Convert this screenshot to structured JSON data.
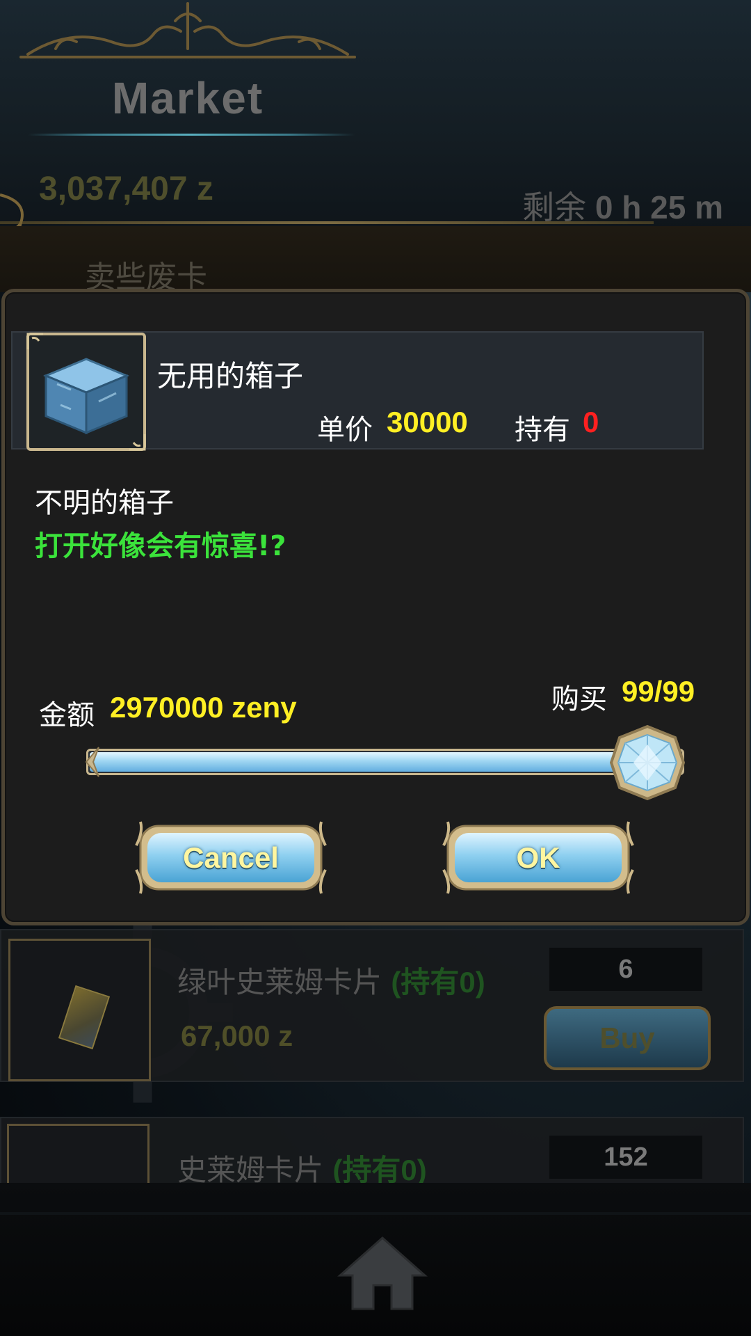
{
  "header": {
    "title": "Market",
    "money": "3,037,407 z",
    "remaining_label": "剩余",
    "remaining_value": " 0 h 25 m",
    "sell_label": "卖些废卡"
  },
  "dialog": {
    "item_name": "无用的箱子",
    "unit_price_label": "单价",
    "unit_price_value": "30000",
    "owned_label": "持有",
    "owned_value": "0",
    "description_line1": "不明的箱子",
    "description_line2": "打开好像会有惊喜!?",
    "amount_label": "金额",
    "amount_value": "2970000 zeny",
    "buy_label": "购买",
    "buy_value": "99/99",
    "quantity": {
      "current": 99,
      "max": 99
    },
    "cancel_label": "Cancel",
    "ok_label": "OK"
  },
  "cards": [
    {
      "name": "绿叶史莱姆卡片",
      "owned": "(持有0)",
      "price": "67,000 z",
      "count": "6",
      "buy_label": "Buy"
    },
    {
      "name": "史莱姆卡片",
      "owned": "(持有0)",
      "count": "152"
    }
  ],
  "nav": {
    "home_icon": "home-icon"
  },
  "colors": {
    "highlight_yellow": "#ffef24",
    "owned_red": "#ff2020",
    "description_green": "#3be33b",
    "frame_gold": "#c9b78e"
  }
}
